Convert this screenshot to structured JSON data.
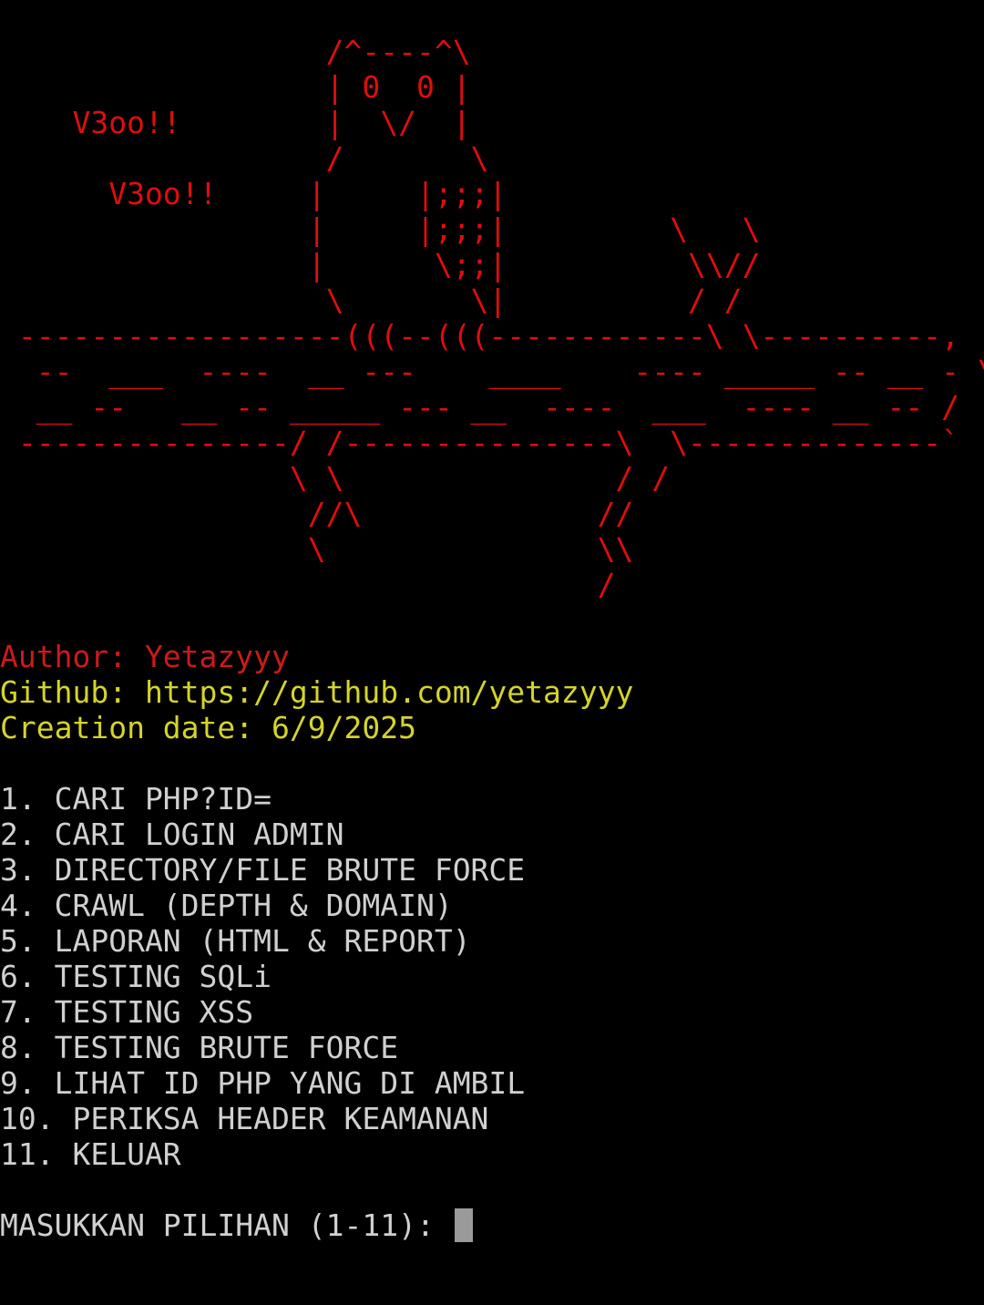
{
  "colors": {
    "background": "#000000",
    "art": "#e00d0d",
    "author": "#cc1a1a",
    "info": "#d4d42a",
    "menu": "#d0d0d0",
    "cursor": "#9a9a9a"
  },
  "ascii_art": [
    "                  /^----^\\",
    "                  | 0  0 |",
    "    V3oo!!        |  \\/  |",
    "                  /       \\",
    "      V3oo!!     |     |;;;|",
    "                 |     |;;;|         \\   \\",
    "                 |      \\;;|          \\\\//",
    "                  \\       \\|          / /",
    " ------------------(((--(((------------\\ \\----------,",
    "  --  ___  ----  __ ---    ____    ---- _____ -- __ - \\",
    "  __ --   __ -- _____ --- __  ----  ___  ---- __ -- /",
    " ---------------/ /---------------\\  \\--------------`",
    "                \\ \\               / /",
    "                 //\\             //",
    "                 \\               \\\\",
    "                                 /"
  ],
  "info": {
    "author": "Author: Yetazyyy",
    "github": "Github: https://github.com/yetazyyy",
    "creation_date": "Creation date: 6/9/2025"
  },
  "menu": {
    "items": [
      "1. CARI PHP?ID=",
      "2. CARI LOGIN ADMIN",
      "3. DIRECTORY/FILE BRUTE FORCE",
      "4. CRAWL (DEPTH & DOMAIN)",
      "5. LAPORAN (HTML & REPORT)",
      "6. TESTING SQLi",
      "7. TESTING XSS",
      "8. TESTING BRUTE FORCE",
      "9. LIHAT ID PHP YANG DI AMBIL",
      "10. PERIKSA HEADER KEAMANAN",
      "11. KELUAR"
    ]
  },
  "prompt": {
    "label": "MASUKKAN PILIHAN (1-11): "
  }
}
